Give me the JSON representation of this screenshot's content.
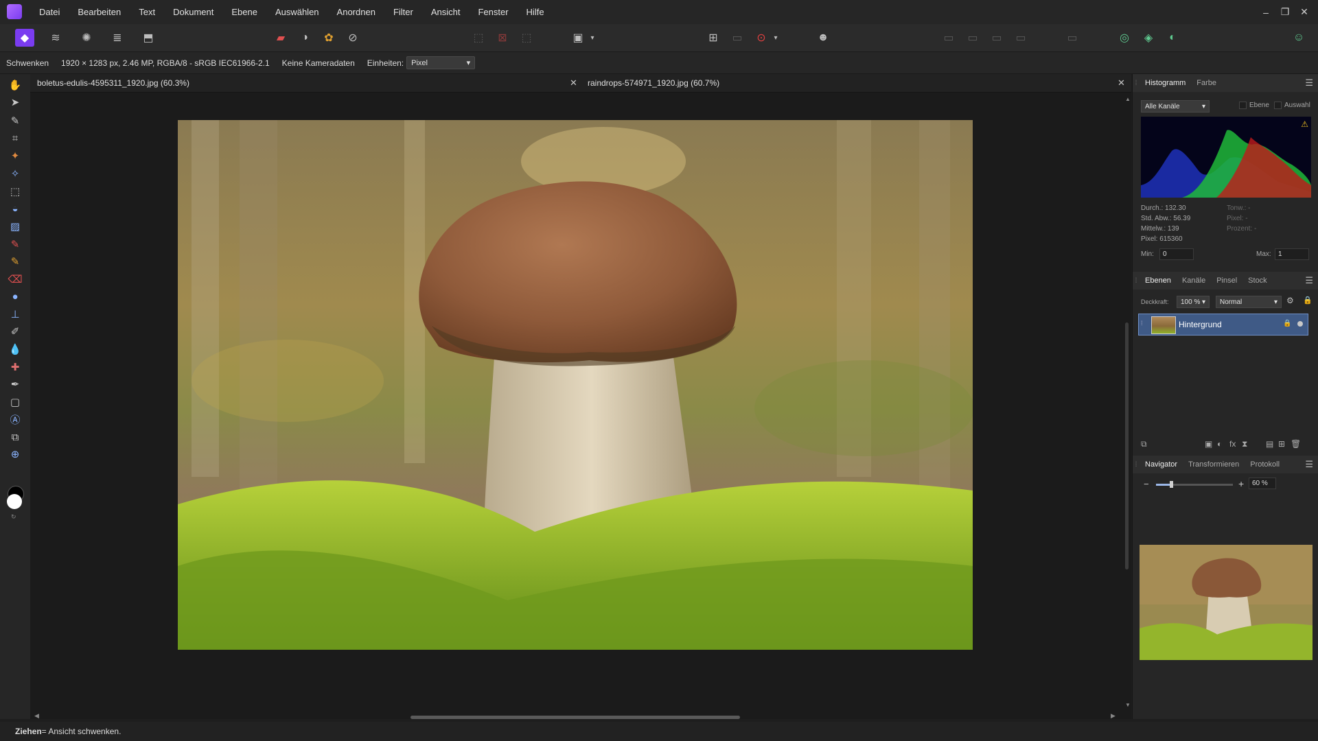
{
  "menu": [
    "Datei",
    "Bearbeiten",
    "Text",
    "Dokument",
    "Ebene",
    "Auswählen",
    "Anordnen",
    "Filter",
    "Ansicht",
    "Fenster",
    "Hilfe"
  ],
  "window": {
    "minimize": "–",
    "maximize": "❐",
    "close": "✕"
  },
  "context": {
    "tool": "Schwenken",
    "doc_info": "1920 × 1283 px, 2.46 MP, RGBA/8 - sRGB IEC61966-2.1",
    "camera": "Keine Kameradaten",
    "units_label": "Einheiten:",
    "units_value": "Pixel"
  },
  "tabs": [
    {
      "label": "boletus-edulis-4595311_1920.jpg (60.3%)",
      "close": "✕"
    },
    {
      "label": "raindrops-574971_1920.jpg (60.7%)",
      "close": "✕"
    }
  ],
  "histogram": {
    "tabs": [
      "Histogramm",
      "Farbe"
    ],
    "channel": "Alle Kanäle",
    "chk_layer": "Ebene",
    "chk_selection": "Auswahl",
    "stats": {
      "mean": "Durch.: 132.30",
      "std": "Std. Abw.: 56.39",
      "median": "Mittelw.: 139",
      "pixels": "Pixel: 615360",
      "tone": "Tonw.: -",
      "pixel2": "Pixel: -",
      "percent": "Prozent: -"
    },
    "min_label": "Min:",
    "min_value": "0",
    "max_label": "Max:",
    "max_value": "1"
  },
  "layers": {
    "tabs": [
      "Ebenen",
      "Kanäle",
      "Pinsel",
      "Stock"
    ],
    "opacity_label": "Deckkraft:",
    "opacity_value": "100 %",
    "blend_mode": "Normal",
    "layer_name": "Hintergrund"
  },
  "navigator": {
    "tabs": [
      "Navigator",
      "Transformieren",
      "Protokoll"
    ],
    "zoom": "60 %",
    "zoom_fraction": 0.2
  },
  "status": {
    "key": "Ziehen",
    "text": " = Ansicht schwenken."
  },
  "colors": {
    "accent": "#7a3cf0",
    "layer_selection": "#3f5a86"
  }
}
